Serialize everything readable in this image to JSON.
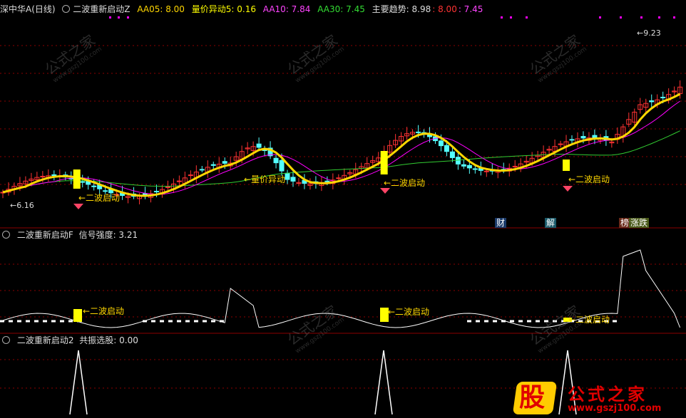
{
  "colors": {
    "background": "#000000",
    "up": "#ff3333",
    "down": "#54ffff",
    "yellow": "#ffff00",
    "magenta": "#ff00ff",
    "green": "#32cd32",
    "gold": "#ffd700",
    "grid": "#8b0000"
  },
  "main_header": {
    "title": "深中华A",
    "period": "(日线)",
    "indicator": "二波重新启动Z",
    "aa05": "AA05: 8.00",
    "liangjia": "量价异动5: 0.16",
    "aa10": "AA10: 7.84",
    "aa30": "AA30: 7.45",
    "trend_label": "主要趋势: 8.98",
    "trend_v1": ": 8.00",
    "trend_v2": ": 7.45"
  },
  "main_annotations": {
    "high": "9.23",
    "low": "6.16",
    "launch1": "←二波启动",
    "launch2": "←二波启动",
    "launch3": "←二波启动",
    "volume_anomaly": "←量价异动"
  },
  "event_tags": {
    "cai": "财",
    "jie": "解",
    "bang": "榜",
    "zhangdie": "涨跌"
  },
  "sub1_header": {
    "indicator": "二波重新启动F",
    "signal": "信号强度: 3.21"
  },
  "sub1_annotations": {
    "launch1": "←二波启动",
    "launch2": "←二波启动",
    "launch3": "←二波启动"
  },
  "sub2_header": {
    "indicator": "二波重新启动2",
    "common": "共振选股: 0.00"
  },
  "watermark": {
    "text": "公式之家",
    "url": "www.gszj100.com",
    "logo_char": "股",
    "logo_title": "公式之家",
    "logo_url": "www.gszj100.com"
  }
}
